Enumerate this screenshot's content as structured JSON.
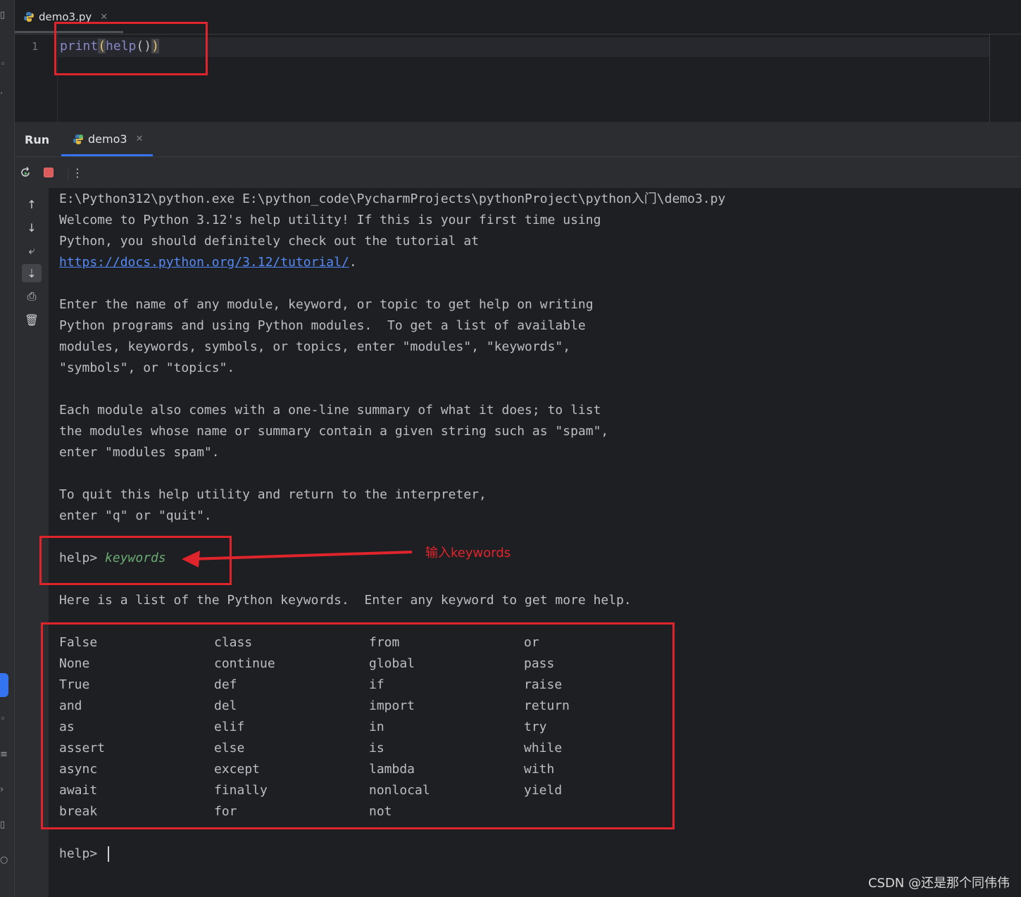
{
  "editor": {
    "tab_title": "demo3.py",
    "line_number": "1",
    "code_fn1": "print",
    "code_open1": "(",
    "code_fn2": "help",
    "code_parens": "()",
    "code_close1": ")"
  },
  "run_panel": {
    "label": "Run",
    "tab_title": "demo3"
  },
  "console": {
    "lines": [
      "E:\\Python312\\python.exe E:\\python_code\\PycharmProjects\\pythonProject\\python入门\\demo3.py",
      "Welcome to Python 3.12's help utility! If this is your first time using",
      "Python, you should definitely check out the tutorial at",
      "",
      "",
      "Enter the name of any module, keyword, or topic to get help on writing",
      "Python programs and using Python modules.  To get a list of available",
      "modules, keywords, symbols, or topics, enter \"modules\", \"keywords\",",
      "\"symbols\", or \"topics\".",
      "",
      "Each module also comes with a one-line summary of what it does; to list",
      "the modules whose name or summary contain a given string such as \"spam\",",
      "enter \"modules spam\".",
      "",
      "To quit this help utility and return to the interpreter,",
      "enter \"q\" or \"quit\"."
    ],
    "tutorial_link": "https://docs.python.org/3.12/tutorial/",
    "link_suffix": ".",
    "prompt": "help> ",
    "user_input": "keywords",
    "keywords_intro": "Here is a list of the Python keywords.  Enter any keyword to get more help.",
    "keywords_columns": [
      [
        "False",
        "None",
        "True",
        "and",
        "as",
        "assert",
        "async",
        "await",
        "break"
      ],
      [
        "class",
        "continue",
        "def",
        "del",
        "elif",
        "else",
        "except",
        "finally",
        "for"
      ],
      [
        "from",
        "global",
        "if",
        "import",
        "in",
        "is",
        "lambda",
        "nonlocal",
        "not"
      ],
      [
        "or",
        "pass",
        "raise",
        "return",
        "try",
        "while",
        "with",
        "yield"
      ]
    ],
    "final_prompt": "help> "
  },
  "annotation": {
    "text": "输入keywords",
    "color": "#e0242c"
  },
  "watermark": "CSDN @还是那个同伟伟",
  "colors": {
    "background": "#1e1f22",
    "panel": "#2b2d30",
    "accent": "#3574f0",
    "link": "#548af7",
    "user_input": "#6aab73"
  }
}
